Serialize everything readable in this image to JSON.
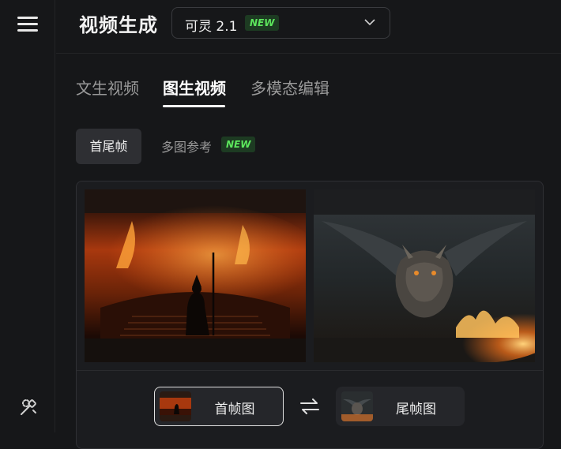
{
  "sidebar": {
    "menu_icon": "hamburger-menu-icon",
    "tool_icon": "magic-wand-icon"
  },
  "header": {
    "title": "视频生成",
    "model_select": {
      "value": "可灵 2.1",
      "badge": "NEW",
      "icon": "chevron-down-icon"
    }
  },
  "tabs": [
    {
      "label": "文生视频",
      "active": false
    },
    {
      "label": "图生视频",
      "active": true
    },
    {
      "label": "多模态编辑",
      "active": false
    }
  ],
  "mode": {
    "options": [
      {
        "label": "首尾帧",
        "active": true
      },
      {
        "label": "多图参考",
        "active": false,
        "badge": "NEW"
      }
    ]
  },
  "frames": {
    "first_label": "首帧图",
    "last_label": "尾帧图",
    "swap_icon": "swap-arrows-icon"
  },
  "colors": {
    "accent_badge_bg": "#1d3b22",
    "accent_badge_text": "#5ce65c",
    "background": "#161719"
  }
}
